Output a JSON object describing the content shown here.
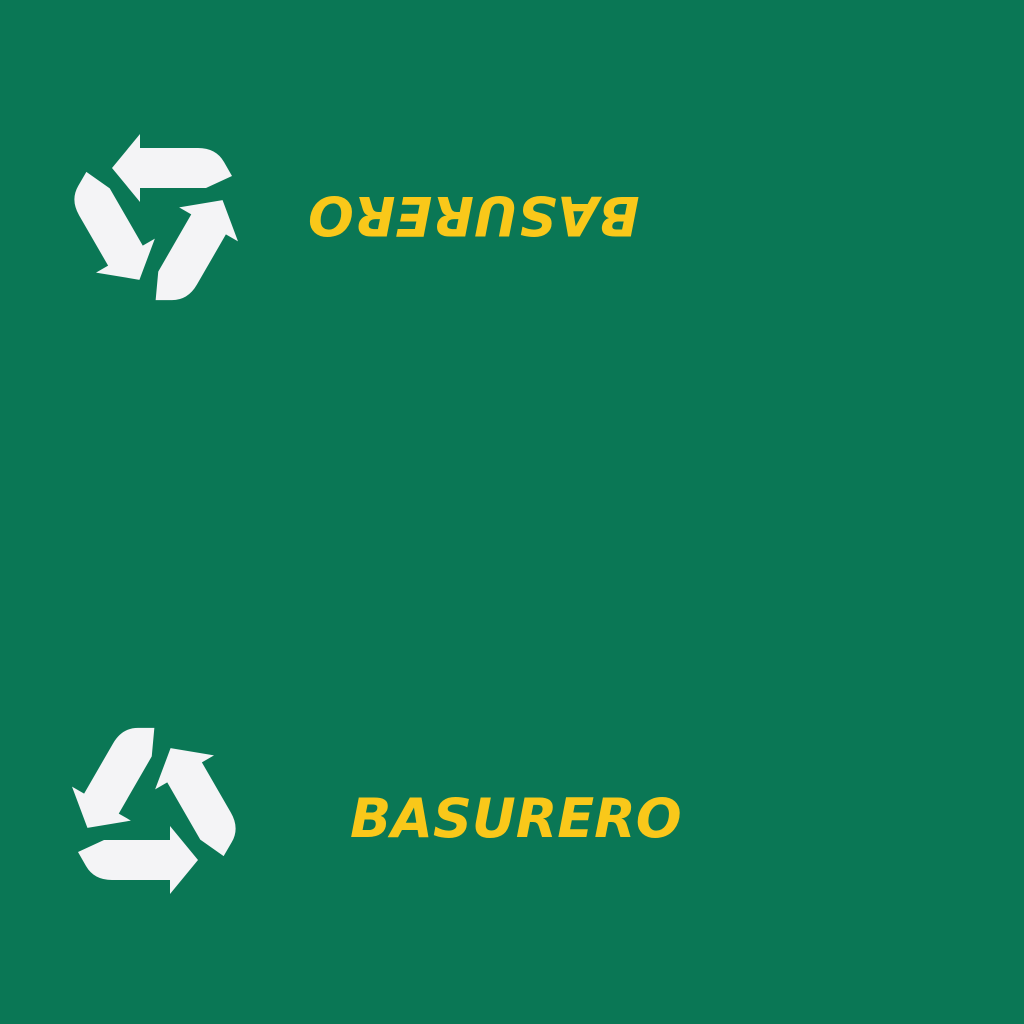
{
  "colors": {
    "background": "#0a7755",
    "text": "#f9c81a",
    "icon": "#f4f4f6"
  },
  "top_sign": {
    "label": "BASURERO",
    "icon": "recycle-icon",
    "orientation": "upside-down"
  },
  "bottom_sign": {
    "label": "BASURERO",
    "icon": "recycle-icon",
    "orientation": "upright"
  }
}
